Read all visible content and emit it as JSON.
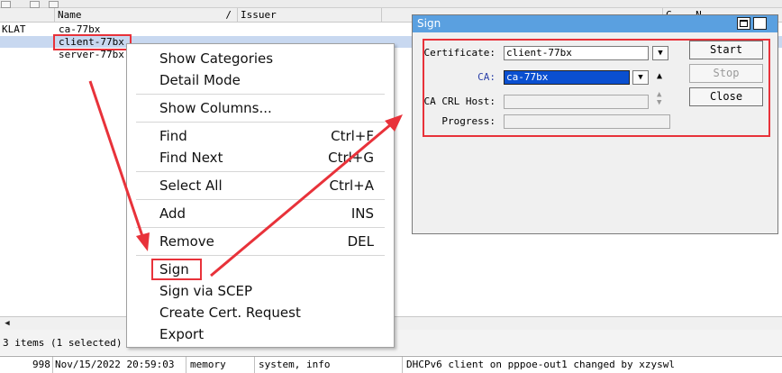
{
  "table": {
    "columns": [
      {
        "label": "",
        "sort": ""
      },
      {
        "label": "Name",
        "sort": "/"
      },
      {
        "label": "Issuer",
        "sort": ""
      },
      {
        "label": "",
        "sort": ""
      },
      {
        "label": "C... N",
        "sort": ""
      }
    ],
    "rows": [
      {
        "flag": "KLAT",
        "name": "ca-77bx",
        "selected": false
      },
      {
        "flag": "",
        "name": "client-77bx",
        "selected": true
      },
      {
        "flag": "",
        "name": "server-77bx",
        "selected": false
      }
    ]
  },
  "status_bar": {
    "items_text": "3 items (1 selected)"
  },
  "log": {
    "id": "998",
    "datetime": "Nov/15/2022 20:59:03",
    "buffer": "memory",
    "topics": "system, info",
    "message": "DHCPv6 client on pppoe-out1 changed by xzyswl"
  },
  "context_menu": {
    "items": [
      {
        "label": "Show Categories",
        "shortcut": ""
      },
      {
        "label": "Detail Mode",
        "shortcut": ""
      },
      {
        "label": "Show Columns...",
        "shortcut": ""
      },
      {
        "label": "Find",
        "shortcut": "Ctrl+F"
      },
      {
        "label": "Find Next",
        "shortcut": "Ctrl+G"
      },
      {
        "label": "Select All",
        "shortcut": "Ctrl+A"
      },
      {
        "label": "Add",
        "shortcut": "INS"
      },
      {
        "label": "Remove",
        "shortcut": "DEL"
      },
      {
        "label": "Sign",
        "shortcut": ""
      },
      {
        "label": "Sign via SCEP",
        "shortcut": ""
      },
      {
        "label": "Create Cert. Request",
        "shortcut": ""
      },
      {
        "label": "Export",
        "shortcut": ""
      }
    ]
  },
  "sign_dialog": {
    "title": "Sign",
    "fields": {
      "certificate": {
        "label": "Certificate:",
        "value": "client-77bx"
      },
      "ca": {
        "label": "CA:",
        "value": "ca-77bx"
      },
      "ca_crl_host": {
        "label": "CA CRL Host:",
        "value": ""
      },
      "progress": {
        "label": "Progress:",
        "value": ""
      }
    },
    "buttons": {
      "start": "Start",
      "stop": "Stop",
      "close": "Close"
    }
  },
  "colors": {
    "title_bar": "#5aa0e0",
    "selection": "#0a4fd0",
    "annotation_red": "#e8323a",
    "ca_label": "#2a3fa8"
  }
}
